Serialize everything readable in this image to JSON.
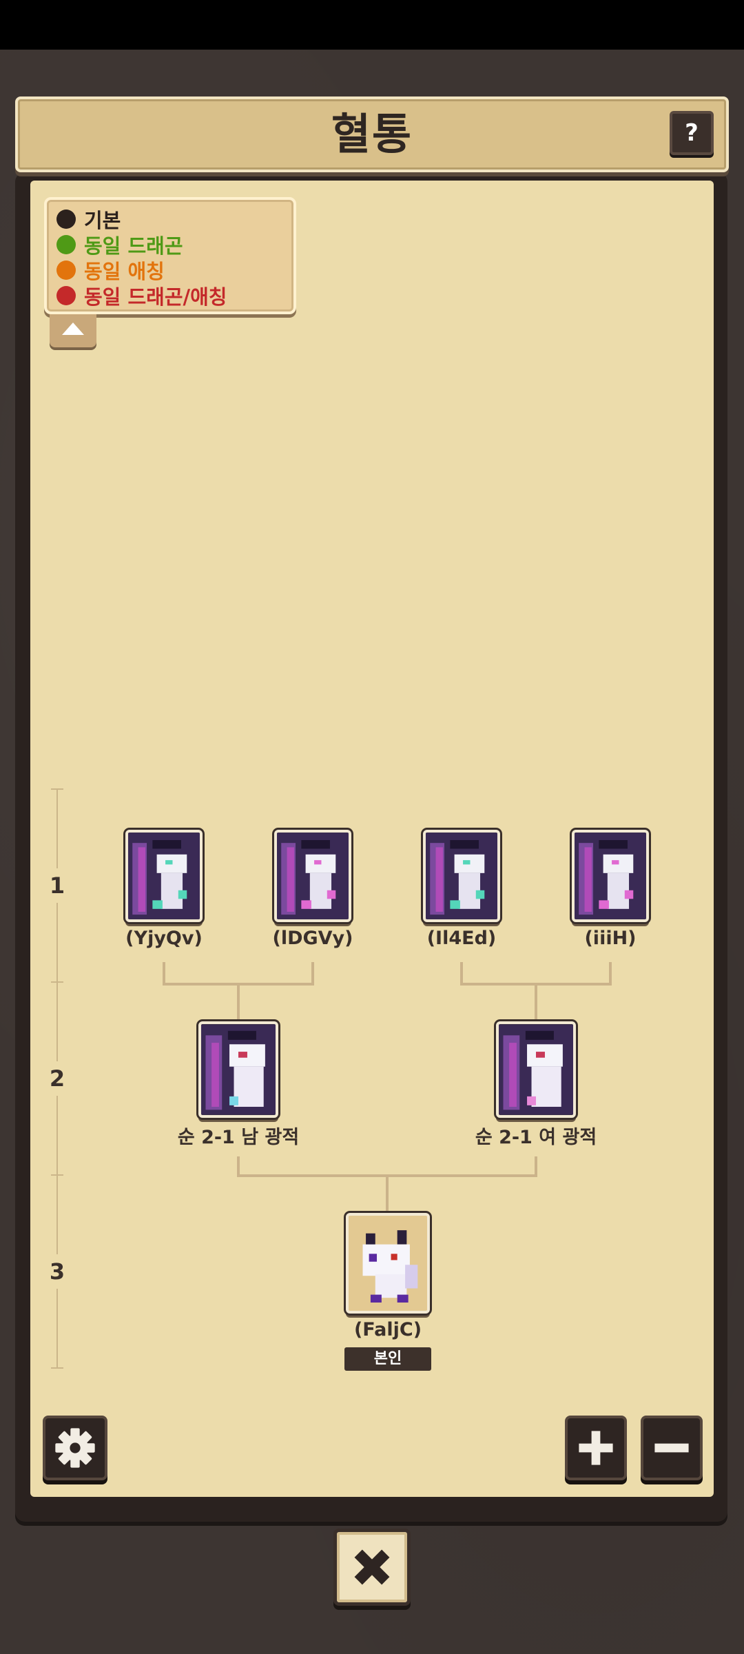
{
  "header": {
    "title": "혈통",
    "help_label": "?"
  },
  "legend": {
    "items": [
      {
        "label": "기본",
        "color": "#2b211d"
      },
      {
        "label": "동일 드래곤",
        "color": "#4f9a16"
      },
      {
        "label": "동일 애칭",
        "color": "#e2740d"
      },
      {
        "label": "동일 드래곤/애칭",
        "color": "#c4292a"
      }
    ]
  },
  "generations": [
    "1",
    "2",
    "3"
  ],
  "tree": {
    "gen1": [
      {
        "name": "(YjyQv)",
        "accent": "#54d6b9"
      },
      {
        "name": "(lDGVy)",
        "accent": "#e06ad1"
      },
      {
        "name": "(Il4Ed)",
        "accent": "#54d6b9"
      },
      {
        "name": "(iiiH)",
        "accent": "#e06ad1"
      }
    ],
    "gen2": [
      {
        "name": "순 2-1 남 광적",
        "accent": "#7ad7e8"
      },
      {
        "name": "순 2-1 여 광적",
        "accent": "#e889d8"
      }
    ],
    "self": {
      "name": "(FaljC)",
      "badge": "본인"
    }
  },
  "controls": {
    "settings_icon": "gear-icon",
    "zoom_in_icon": "plus-icon",
    "zoom_out_icon": "minus-icon",
    "close_icon": "close-icon"
  }
}
